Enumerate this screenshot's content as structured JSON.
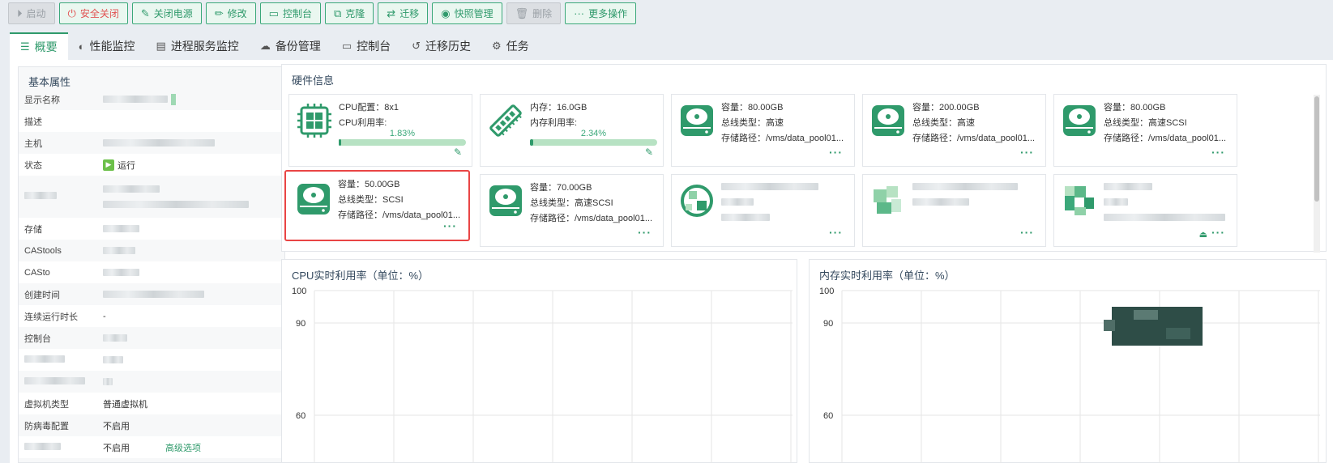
{
  "toolbar": {
    "start": "启动",
    "safe_shutdown": "安全关闭",
    "power_off": "关闭电源",
    "edit": "修改",
    "console": "控制台",
    "clone": "克隆",
    "migrate": "迁移",
    "snapshot": "快照管理",
    "delete": "删除",
    "more": "更多操作"
  },
  "tabs": [
    "概要",
    "性能监控",
    "进程服务监控",
    "备份管理",
    "控制台",
    "迁移历史",
    "任务"
  ],
  "basic": {
    "title": "基本属性",
    "rows": [
      {
        "label": "显示名称",
        "value": ""
      },
      {
        "label": "描述",
        "value": ""
      },
      {
        "label": "主机",
        "value": ""
      },
      {
        "label": "状态",
        "value": "运行"
      },
      {
        "label": "",
        "value": ""
      },
      {
        "label": "存储",
        "value": ""
      },
      {
        "label": "CAStools",
        "value": ""
      },
      {
        "label": "CASto",
        "value": ""
      },
      {
        "label": "创建时间",
        "value": ""
      },
      {
        "label": "连续运行时长",
        "value": "-"
      },
      {
        "label": "控制台",
        "value": ""
      },
      {
        "label": "",
        "value": ""
      },
      {
        "label": "",
        "value": ""
      },
      {
        "label": "虚拟机类型",
        "value": "普通虚拟机"
      },
      {
        "label": "防病毒配置",
        "value": "不启用"
      },
      {
        "label": "",
        "value": "不启用",
        "link": "高级选项"
      }
    ]
  },
  "hardware": {
    "title": "硬件信息",
    "cpu": {
      "config": "CPU配置：8x1",
      "usage_label": "CPU利用率:",
      "usage": "1.83%",
      "usage_value": 1.83
    },
    "memory": {
      "size": "内存：16.0GB",
      "usage_label": "内存利用率:",
      "usage": "2.34%",
      "usage_value": 2.34
    },
    "disks": [
      {
        "capacity": "容量：80.00GB",
        "bus": "总线类型：高速",
        "path": "存储路径：/vms/data_pool01..."
      },
      {
        "capacity": "容量：200.00GB",
        "bus": "总线类型：高速",
        "path": "存储路径：/vms/data_pool01..."
      },
      {
        "capacity": "容量：80.00GB",
        "bus": "总线类型：高速SCSI",
        "path": "存储路径：/vms/data_pool01..."
      },
      {
        "capacity": "容量：50.00GB",
        "bus": "总线类型：SCSI",
        "path": "存储路径：/vms/data_pool01..."
      },
      {
        "capacity": "容量：70.00GB",
        "bus": "总线类型：高速SCSI",
        "path": "存储路径：/vms/data_pool01..."
      }
    ],
    "more": "···"
  },
  "charts": [
    {
      "title": "CPU实时利用率（单位：%）",
      "yticks": [
        100,
        90,
        60
      ]
    },
    {
      "title": "内存实时利用率（单位：%）",
      "yticks": [
        100,
        90,
        60
      ]
    }
  ],
  "colors": {
    "accent": "#2f9a6b",
    "selected_border": "#e94545",
    "danger": "#e25353"
  }
}
